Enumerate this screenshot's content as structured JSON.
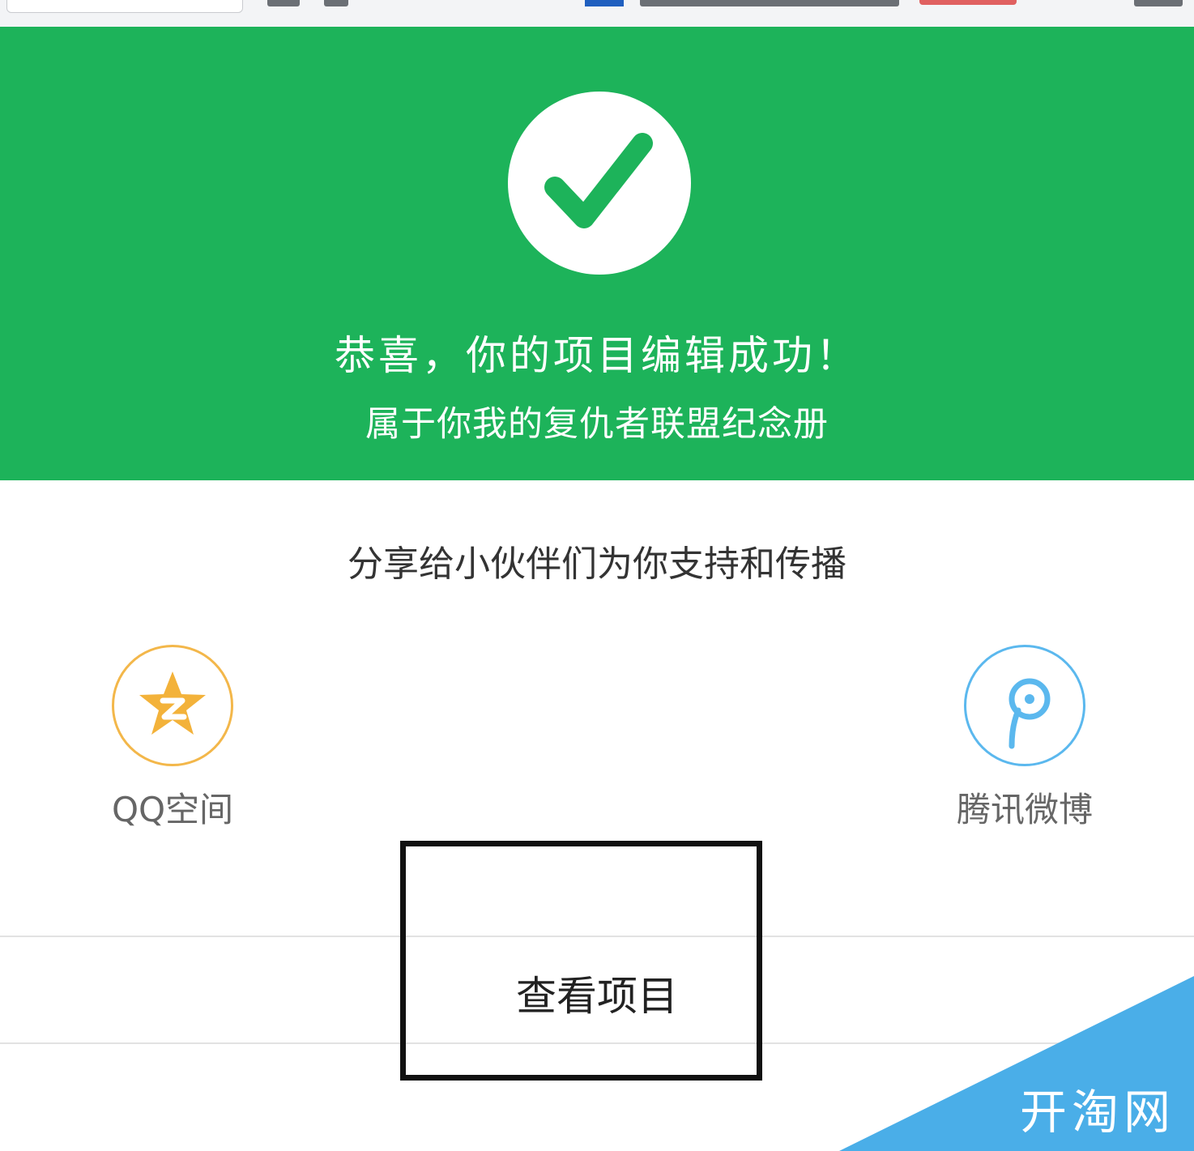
{
  "banner": {
    "title": "恭喜，你的项目编辑成功！",
    "subtitle": "属于你我的复仇者联盟纪念册"
  },
  "share": {
    "heading": "分享给小伙伴们为你支持和传播",
    "items": [
      {
        "label": "QQ空间",
        "icon": "qzone-star-icon"
      },
      {
        "label": "腾讯微博",
        "icon": "tencent-weibo-icon"
      }
    ]
  },
  "action": {
    "view_project_label": "查看项目"
  },
  "watermark": {
    "text": "开淘网"
  },
  "colors": {
    "banner_green": "#1db35a",
    "qzone_orange": "#f3b74a",
    "weibo_blue": "#5bb8ee",
    "watermark_blue": "#4aaee8"
  }
}
